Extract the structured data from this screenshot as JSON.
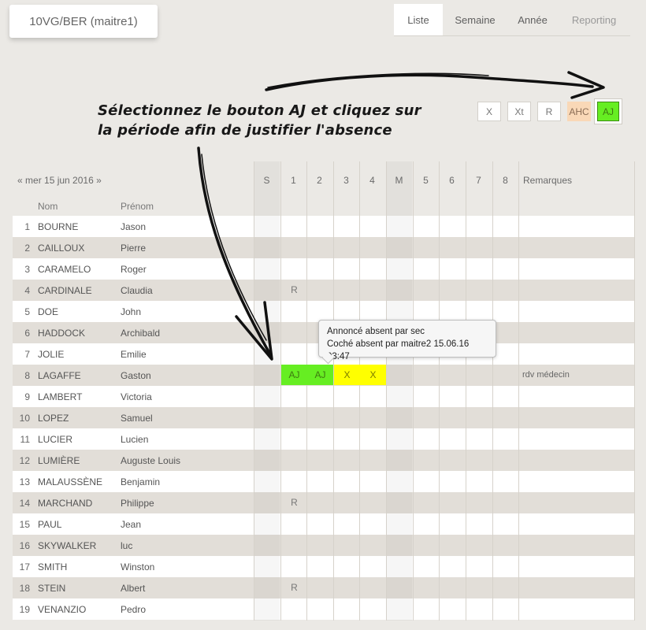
{
  "class_label": "10VG/BER (maitre1)",
  "tabs": [
    {
      "label": "Liste",
      "active": true
    },
    {
      "label": "Semaine"
    },
    {
      "label": "Année"
    },
    {
      "label": "Reporting"
    }
  ],
  "annotation": [
    "Sélectionnez le bouton AJ et cliquez sur",
    "la période afin de justifier l'absence"
  ],
  "tools": [
    {
      "label": "X",
      "color": "#ffffff"
    },
    {
      "label": "Xt",
      "color": "#ffffff"
    },
    {
      "label": "R",
      "color": "#ffffff"
    },
    {
      "label": "AHC",
      "color": "#f9d8b7"
    },
    {
      "label": "AJ",
      "color": "#66ee22",
      "selected": true
    }
  ],
  "date_nav": {
    "prev": "«",
    "date": "mer 15 jun 2016",
    "next": "»"
  },
  "columns": [
    "S",
    "1",
    "2",
    "3",
    "4",
    "M",
    "5",
    "6",
    "7",
    "8"
  ],
  "remarks_header": "Remarques",
  "subheaders": {
    "nom": "Nom",
    "prenom": "Prénom"
  },
  "colors": {
    "green": "#66ee22",
    "yellow": "#ffff00",
    "ahc": "#f9d8b7"
  },
  "students": [
    {
      "num": "1",
      "nom": "BOURNE",
      "prenom": "Jason",
      "marks": {},
      "remark": ""
    },
    {
      "num": "2",
      "nom": "CAILLOUX",
      "prenom": "Pierre",
      "marks": {},
      "remark": ""
    },
    {
      "num": "3",
      "nom": "CARAMELO",
      "prenom": "Roger",
      "marks": {},
      "remark": ""
    },
    {
      "num": "4",
      "nom": "CARDINALE",
      "prenom": "Claudia",
      "marks": {
        "1": "R"
      },
      "remark": ""
    },
    {
      "num": "5",
      "nom": "DOE",
      "prenom": "John",
      "marks": {},
      "remark": ""
    },
    {
      "num": "6",
      "nom": "HADDOCK",
      "prenom": "Archibald",
      "marks": {},
      "remark": ""
    },
    {
      "num": "7",
      "nom": "JOLIE",
      "prenom": "Emilie",
      "marks": {},
      "remark": ""
    },
    {
      "num": "8",
      "nom": "LAGAFFE",
      "prenom": "Gaston",
      "marks": {
        "1": "AJ",
        "2": "AJ",
        "3": "X",
        "4": "X"
      },
      "remark": "rdv médecin"
    },
    {
      "num": "9",
      "nom": "LAMBERT",
      "prenom": "Victoria",
      "marks": {},
      "remark": ""
    },
    {
      "num": "10",
      "nom": "LOPEZ",
      "prenom": "Samuel",
      "marks": {},
      "remark": ""
    },
    {
      "num": "11",
      "nom": "LUCIER",
      "prenom": "Lucien",
      "marks": {},
      "remark": ""
    },
    {
      "num": "12",
      "nom": "LUMIÈRE",
      "prenom": "Auguste Louis",
      "marks": {},
      "remark": ""
    },
    {
      "num": "13",
      "nom": "MALAUSSÈNE",
      "prenom": "Benjamin",
      "marks": {},
      "remark": ""
    },
    {
      "num": "14",
      "nom": "MARCHAND",
      "prenom": "Philippe",
      "marks": {
        "1": "R"
      },
      "remark": ""
    },
    {
      "num": "15",
      "nom": "PAUL",
      "prenom": "Jean",
      "marks": {},
      "remark": ""
    },
    {
      "num": "16",
      "nom": "SKYWALKER",
      "prenom": "luc",
      "marks": {},
      "remark": ""
    },
    {
      "num": "17",
      "nom": "SMITH",
      "prenom": "Winston",
      "marks": {},
      "remark": ""
    },
    {
      "num": "18",
      "nom": "STEIN",
      "prenom": "Albert",
      "marks": {
        "1": "R"
      },
      "remark": ""
    },
    {
      "num": "19",
      "nom": "VENANZIO",
      "prenom": "Pedro",
      "marks": {},
      "remark": ""
    }
  ],
  "tooltip": [
    "Annoncé absent par sec",
    "Coché absent par maitre2 15.06.16 03:47"
  ]
}
